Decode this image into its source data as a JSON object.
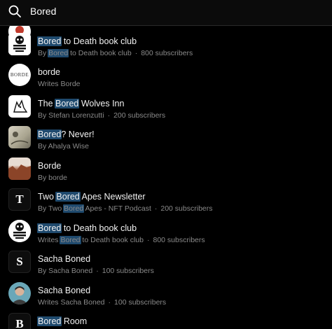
{
  "search": {
    "query": "Bored",
    "icon": "search-icon"
  },
  "colors": {
    "highlight": "#1f4a6e",
    "background": "#000000",
    "subtext": "#8a8a8a"
  },
  "results": [
    {
      "title": [
        {
          "t": "Bored",
          "h": true
        },
        {
          "t": " to Death book club",
          "h": false
        }
      ],
      "subtitle": [
        {
          "t": "By ",
          "h": false
        },
        {
          "t": "Bored",
          "h": true
        },
        {
          "t": " to Death book club",
          "h": false
        }
      ],
      "subscribers": "800 subscribers",
      "avatar": "skull-logo"
    },
    {
      "title": [
        {
          "t": "borde",
          "h": false
        }
      ],
      "subtitle": [
        {
          "t": "Writes Borde",
          "h": false
        }
      ],
      "subscribers": "",
      "avatar": "borde-logo"
    },
    {
      "title": [
        {
          "t": "The ",
          "h": false
        },
        {
          "t": "Bored",
          "h": true
        },
        {
          "t": " Wolves Inn",
          "h": false
        }
      ],
      "subtitle": [
        {
          "t": "By Stefan Lorenzutti",
          "h": false
        }
      ],
      "subscribers": "200 subscribers",
      "avatar": "wolf-sketch"
    },
    {
      "title": [
        {
          "t": "Bored",
          "h": true
        },
        {
          "t": "? Never!",
          "h": false
        }
      ],
      "subtitle": [
        {
          "t": "By Ahalya Wise",
          "h": false
        }
      ],
      "subscribers": "",
      "avatar": "sketch-photo"
    },
    {
      "title": [
        {
          "t": "Borde",
          "h": false
        }
      ],
      "subtitle": [
        {
          "t": "By borde",
          "h": false
        }
      ],
      "subscribers": "",
      "avatar": "rock-photo"
    },
    {
      "title": [
        {
          "t": "Two ",
          "h": false
        },
        {
          "t": "Bored",
          "h": true
        },
        {
          "t": " Apes Newsletter",
          "h": false
        }
      ],
      "subtitle": [
        {
          "t": "By Two ",
          "h": false
        },
        {
          "t": "Bored",
          "h": true
        },
        {
          "t": " Apes - NFT Podcast",
          "h": false
        }
      ],
      "subscribers": "200 subscribers",
      "avatar": "letter-t"
    },
    {
      "title": [
        {
          "t": "Bored",
          "h": true
        },
        {
          "t": " to Death book club",
          "h": false
        }
      ],
      "subtitle": [
        {
          "t": "Writes ",
          "h": false
        },
        {
          "t": "Bored",
          "h": true
        },
        {
          "t": " to Death book club",
          "h": false
        }
      ],
      "subscribers": "800 subscribers",
      "avatar": "skull-logo-round"
    },
    {
      "title": [
        {
          "t": "Sacha Boned",
          "h": false
        }
      ],
      "subtitle": [
        {
          "t": "By Sacha Boned",
          "h": false
        }
      ],
      "subscribers": "100 subscribers",
      "avatar": "letter-s"
    },
    {
      "title": [
        {
          "t": "Sacha Boned",
          "h": false
        }
      ],
      "subtitle": [
        {
          "t": "Writes Sacha Boned",
          "h": false
        }
      ],
      "subscribers": "100 subscribers",
      "avatar": "person-photo"
    },
    {
      "title": [
        {
          "t": "Bored",
          "h": true
        },
        {
          "t": " Room",
          "h": false
        }
      ],
      "subtitle": [],
      "subscribers": "",
      "avatar": "letter-b"
    }
  ],
  "avatar_letters": {
    "letter-t": "T",
    "letter-s": "S",
    "letter-b": "B",
    "borde-logo": "BORDE"
  }
}
